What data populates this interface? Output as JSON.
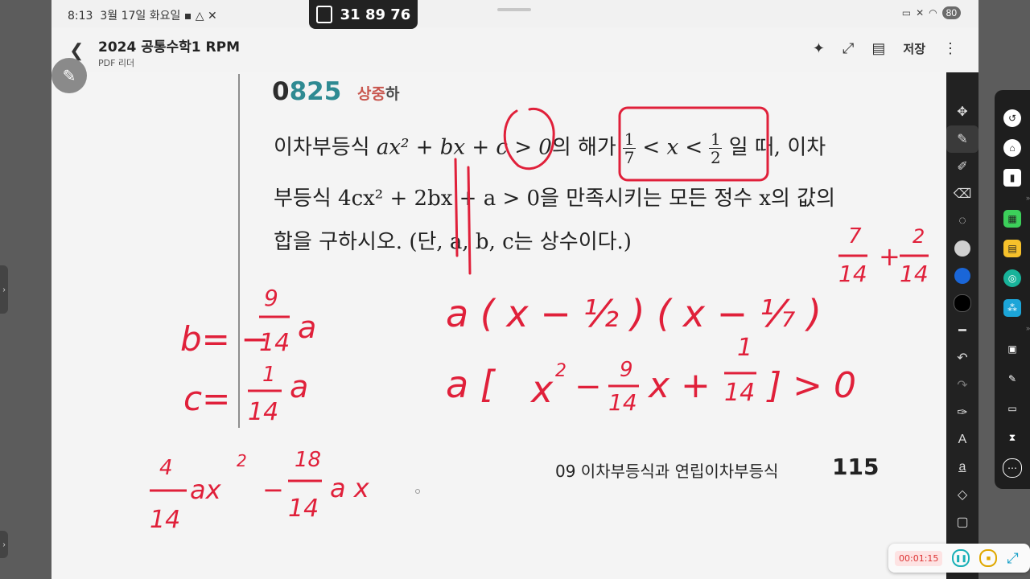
{
  "status_bar": {
    "time": "8:13",
    "date": "3월 17일 화요일",
    "battery": "80"
  },
  "camera_chip": {
    "code": "31 89 76"
  },
  "app_bar": {
    "title": "2024 공통수학1 RPM",
    "subtitle": "PDF 리더",
    "save_label": "저장"
  },
  "problem": {
    "number_first": "0",
    "number_rest": "825",
    "difficulty": [
      "상",
      "중",
      "하"
    ],
    "line1_pre": "이차부등식 ",
    "line1_expr": "ax² + bx + c > 0",
    "line1_mid": "의 해가 ",
    "frac1_num": "1",
    "frac1_den": "7",
    "frac2_num": "1",
    "frac2_den": "2",
    "line1_post": "일 때, 이차",
    "line2": "부등식 4cx² + 2bx + a > 0을 만족시키는 모든 정수 x의 값의",
    "line3": "합을 구하시오. (단, a, b, c는 상수이다.)"
  },
  "footer": {
    "chapter": "09 이차부등식과 연립이차부등식",
    "page": "115"
  },
  "ink": {
    "color": "#e0203a",
    "b_eq": "b= −",
    "b_num": "9",
    "b_den": "14",
    "b_var": "a",
    "c_eq": "c=",
    "c_num": "1",
    "c_den": "14",
    "c_var": "a",
    "factored": "a ( x − ½ ) ( x − ⅐ )",
    "expanded_a": "a [",
    "expanded_x2": "x",
    "expanded_sup": "2",
    "expanded_minus": "−",
    "expanded_f1n": "9",
    "expanded_f1d": "14",
    "expanded_x": "x +",
    "expanded_f2n": "1",
    "expanded_f2d": "14",
    "expanded_end": "] > 0",
    "sum_n1": "7",
    "sum_d1": "14",
    "sum_plus": "+",
    "sum_n2": "2",
    "sum_d2": "14",
    "bottom_n1": "4",
    "bottom_d1": "14",
    "bottom_t1": "ax",
    "bottom_sup": "2",
    "bottom_minus": "−",
    "bottom_n2": "18",
    "bottom_d2": "14",
    "bottom_t2": "a x"
  },
  "toolbar_colors": [
    "#d0d0d0",
    "#1a66d8",
    "#000000"
  ],
  "recording": {
    "elapsed": "00:01:15"
  },
  "icons": {
    "back": "chevron-left-icon",
    "pen_fab": "pencil-icon",
    "sparkle": "sparkle-icon",
    "expand": "expand-icon",
    "doc_search": "doc-search-icon",
    "more": "more-vert-icon"
  }
}
